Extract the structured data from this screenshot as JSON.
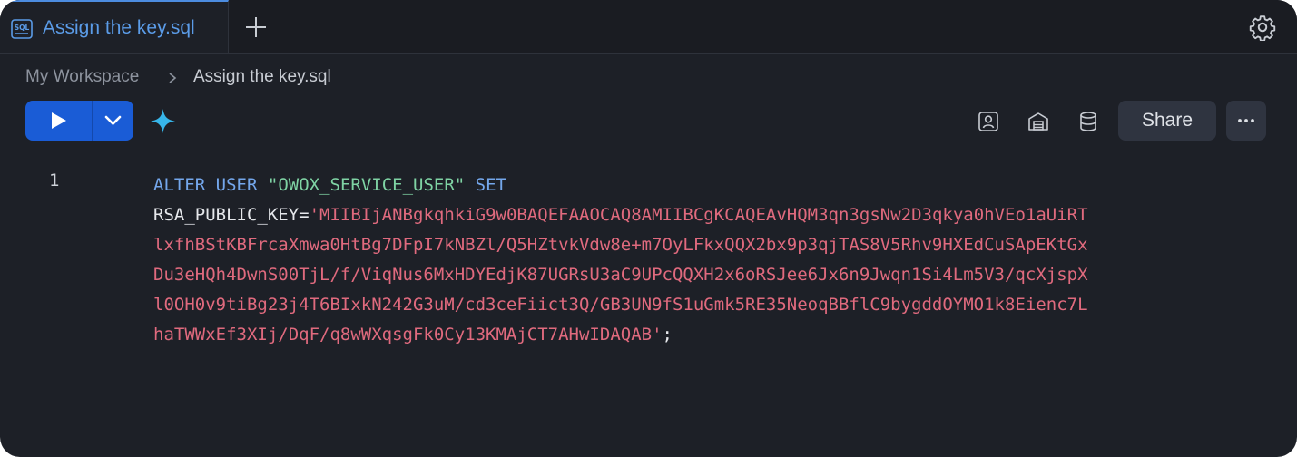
{
  "tab": {
    "title": "Assign the key.sql",
    "icon": "sql-file-icon"
  },
  "breadcrumb": {
    "root": "My Workspace",
    "current": "Assign the key.sql"
  },
  "toolbar": {
    "share_label": "Share"
  },
  "editor": {
    "line_number": "1",
    "keyword_alter": "ALTER",
    "keyword_user": "USER",
    "user_name": "\"OWOX_SERVICE_USER\"",
    "keyword_set": "SET",
    "param_name": "RSA_PUBLIC_KEY",
    "equals": "=",
    "key_lines": [
      "'MIIBIjANBgkqhkiG9w0BAQEFAAOCAQ8AMIIBCgKCAQEAvHQM3qn3gsNw2D3qkya0hVEo1aUiRT",
      "lxfhBStKBFrcaXmwa0HtBg7DFpI7kNBZl/Q5HZtvkVdw8e+m7OyLFkxQQX2bx9p3qjTAS8V5Rhv9HXEdCuSApEKtGx",
      "Du3eHQh4DwnS00TjL/f/ViqNus6MxHDYEdjK87UGRsU3aC9UPcQQXH2x6oRSJee6Jx6n9Jwqn1Si4Lm5V3/qcXjspX",
      "l0OH0v9tiBg23j4T6BIxkN242G3uM/cd3ceFiict3Q/GB3UN9fS1uGmk5RE35NeoqBBflC9bygddOYMO1k8Eienc7L",
      "haTWWxEf3XIj/DqF/q8wWXqsgFk0Cy13KMAjCT7AHwIDAQAB'"
    ],
    "terminator": ";"
  },
  "colors": {
    "background": "#1d2027",
    "accent": "#1a5cd6",
    "keyword": "#74a7ec",
    "string": "#7fd3a4",
    "key_string": "#e06a7e"
  }
}
